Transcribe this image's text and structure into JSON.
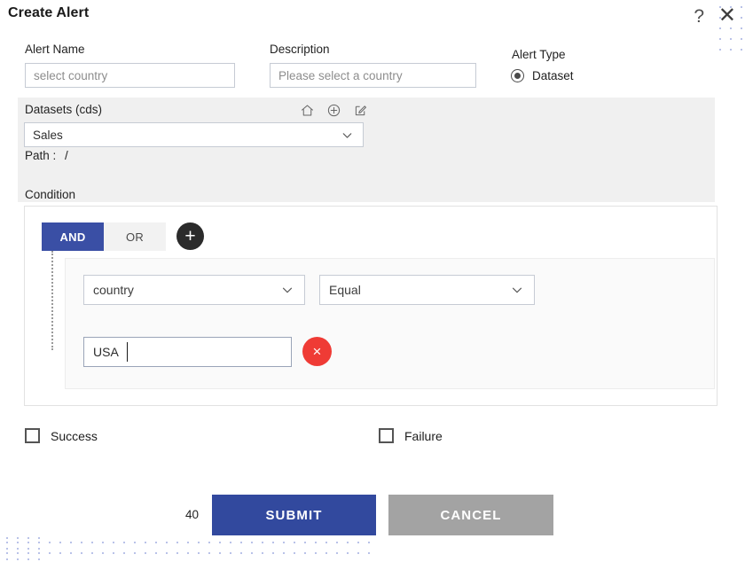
{
  "dialog": {
    "title": "Create Alert",
    "help_icon": "help-question-icon",
    "close_icon": "close-x-icon"
  },
  "form": {
    "alert_name": {
      "label": "Alert Name",
      "value": "select country",
      "placeholder": "select country"
    },
    "description": {
      "label": "Description",
      "value": "",
      "placeholder": "Please select a country"
    },
    "alert_type": {
      "label": "Alert Type",
      "selected": "Dataset",
      "options": [
        "Dataset"
      ]
    }
  },
  "datasets": {
    "label": "Datasets (cds)",
    "selected": "Sales",
    "path_label": "Path :",
    "path_value": "/",
    "icons": [
      {
        "name": "home-icon"
      },
      {
        "name": "add-circle-icon"
      },
      {
        "name": "edit-pencil-icon"
      }
    ]
  },
  "condition": {
    "label": "Condition",
    "logic": {
      "and_label": "AND",
      "or_label": "OR",
      "active": "AND"
    },
    "add_button_label": "+",
    "rows": [
      {
        "field": "country",
        "operator": "Equal",
        "value": "USA",
        "remove_label": "×"
      }
    ]
  },
  "status": {
    "success_label": "Success",
    "success_checked": false,
    "failure_label": "Failure",
    "failure_checked": false
  },
  "footer": {
    "counter": "40",
    "submit_label": "SUBMIT",
    "cancel_label": "CANCEL"
  },
  "colors": {
    "primary_blue": "#32499e",
    "logic_active_blue": "#3a4fa5",
    "cancel_gray": "#a3a3a3",
    "remove_red": "#ef3b35",
    "panel_gray": "#f0f0f0",
    "dot_pattern": "#b9c2e8"
  }
}
